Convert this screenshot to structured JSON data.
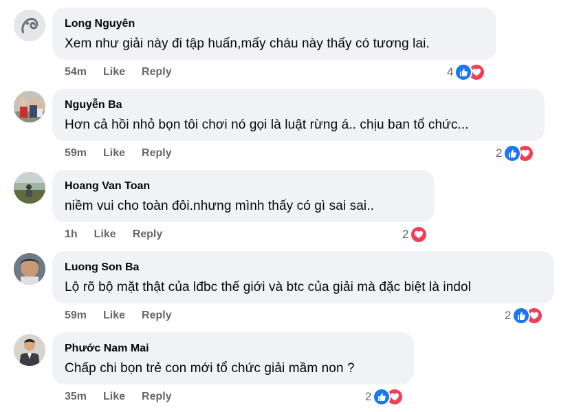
{
  "comments": [
    {
      "author": "Long Nguyên",
      "text": "Xem như giải này đi tập huấn,mấy cháu này thấy có tương lai.",
      "time": "54m",
      "like_label": "Like",
      "reply_label": "Reply",
      "reaction_count": "4",
      "reactions": [
        "like-icon",
        "love-icon"
      ]
    },
    {
      "author": "Nguyễn Ba",
      "text": "Hơn cả hồi nhỏ bọn tôi chơi nó gọi là luật rừng á.. chịu ban tổ chức...",
      "time": "59m",
      "like_label": "Like",
      "reply_label": "Reply",
      "reaction_count": "2",
      "reactions": [
        "like-icon",
        "love-icon"
      ]
    },
    {
      "author": "Hoang Van Toan",
      "text": "niềm vui cho toàn đôi.nhưng mình thấy có gì sai sai..",
      "time": "1h",
      "like_label": "Like",
      "reply_label": "Reply",
      "reaction_count": "2",
      "reactions": [
        "love-icon"
      ]
    },
    {
      "author": "Luong Son Ba",
      "text": "Lộ rõ bộ mặt thật của lđbc thế giới và btc của giải mà đặc biệt là indol",
      "time": "59m",
      "like_label": "Like",
      "reply_label": "Reply",
      "reaction_count": "2",
      "reactions": [
        "like-icon",
        "love-icon"
      ]
    },
    {
      "author": "Phước Nam Mai",
      "text": "Chấp chi bọn trẻ con mới tổ chức giải mầm non ?",
      "time": "35m",
      "like_label": "Like",
      "reply_label": "Reply",
      "reaction_count": "2",
      "reactions": [
        "like-icon",
        "love-icon"
      ]
    }
  ],
  "colors": {
    "bubble": "#f0f2f5",
    "meta_text": "#65676b",
    "like_blue": "#1877f2",
    "love_red": "#f33e58"
  }
}
